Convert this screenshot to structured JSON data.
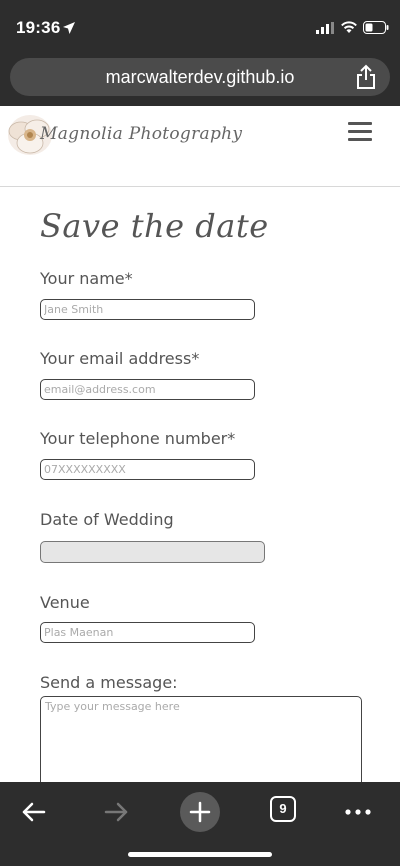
{
  "status_bar": {
    "time": "19:36"
  },
  "browser": {
    "url": "marcwalterdev.github.io",
    "tab_count": "9"
  },
  "site": {
    "brand": "Magnolia Photography"
  },
  "form": {
    "title": "Save the date",
    "fields": [
      {
        "label": "Your name*",
        "placeholder": "Jane Smith",
        "value": ""
      },
      {
        "label": "Your email address*",
        "placeholder": "email@address.com",
        "value": ""
      },
      {
        "label": "Your telephone number*",
        "placeholder": "07XXXXXXXXX",
        "value": ""
      },
      {
        "label": "Date of Wedding",
        "placeholder": "",
        "value": ""
      },
      {
        "label": "Venue",
        "placeholder": "Plas Maenan",
        "value": ""
      },
      {
        "label": "Send a message:",
        "placeholder": "Type your message here",
        "value": ""
      }
    ]
  },
  "colors": {
    "chrome": "#2d2d2d",
    "url_pill": "#4b4b4b",
    "text": "#555555"
  },
  "icons": {
    "location": "location-arrow-icon",
    "signal": "cellular-signal-icon",
    "wifi": "wifi-icon",
    "battery": "battery-icon",
    "share": "share-icon",
    "menu": "hamburger-menu-icon",
    "back": "back-arrow-icon",
    "forward": "forward-arrow-icon",
    "new_tab": "plus-icon",
    "tabs": "tabs-icon",
    "more": "more-dots-icon"
  }
}
